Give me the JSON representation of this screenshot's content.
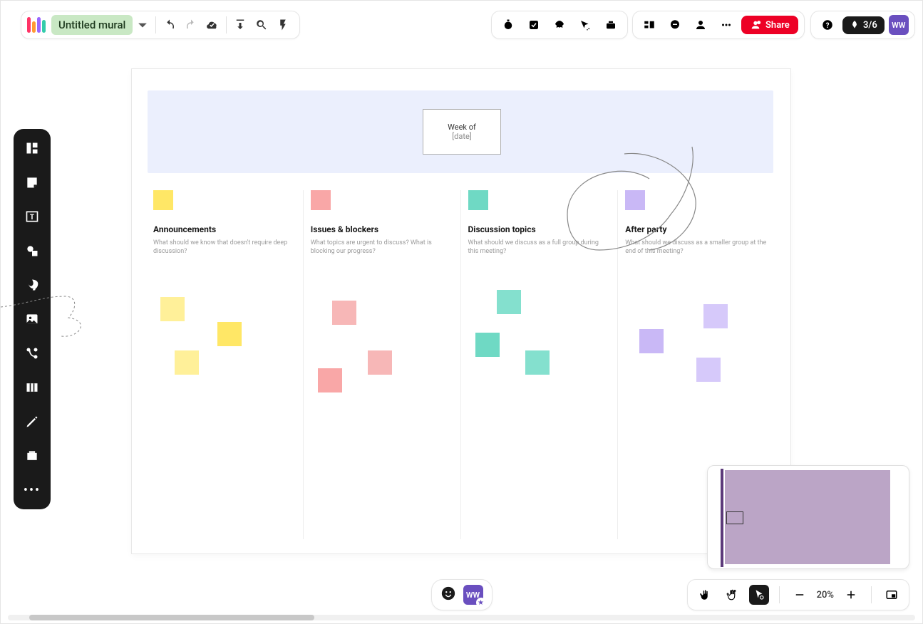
{
  "header": {
    "title": "Untitled mural",
    "onboarding": "3/6",
    "avatar_initials": "WW",
    "share_label": "Share"
  },
  "week_box": {
    "line1": "Week of",
    "line2": "[date]"
  },
  "columns": [
    {
      "title": "Announcements",
      "sub": "What should we know that doesn't require deep discussion?",
      "swatch": "yellow"
    },
    {
      "title": "Issues & blockers",
      "sub": "What topics are urgent to discuss? What is blocking our progress?",
      "swatch": "pink"
    },
    {
      "title": "Discussion topics",
      "sub": "What should we discuss as a full group during this meeting?",
      "swatch": "teal"
    },
    {
      "title": "After party",
      "sub": "What should we discuss as a smaller group at the end of this meeting?",
      "swatch": "purple"
    }
  ],
  "zoom": {
    "level": "20%"
  }
}
